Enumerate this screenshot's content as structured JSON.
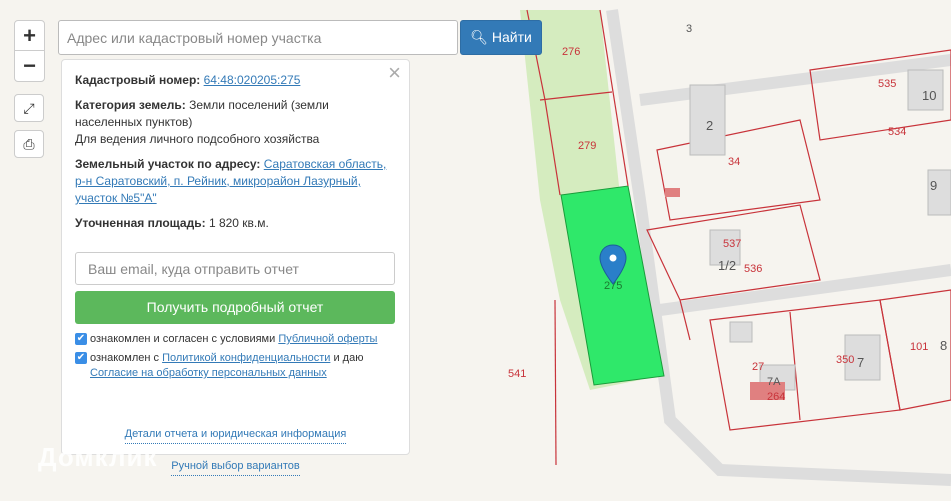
{
  "search": {
    "placeholder": "Адрес или кадастровый номер участка",
    "button": "Найти"
  },
  "zoom": {
    "in": "+",
    "out": "−"
  },
  "panel": {
    "cad_label": "Кадастровый номер:",
    "cad_value": "64:48:020205:275",
    "cat_label": "Категория земель:",
    "cat_value": "Земли поселений (земли населенных пунктов)",
    "use": "Для ведения личного подсобного хозяйства",
    "addr_label": "Земельный участок по адресу:",
    "addr_value": "Саратовская область, р-н Саратовский, п. Рейник, микрорайон Лазурный, участок №5\"А\"",
    "area_label": "Уточненная площадь:",
    "area_value": "1 820 кв.м.",
    "email_placeholder": "Ваш email, куда отправить отчет",
    "get_report": "Получить подробный отчет",
    "agree1_text": "ознакомлен и согласен с условиями",
    "agree1_link": "Публичной оферты",
    "agree2_text": "ознакомлен с",
    "agree2_link": "Политикой конфиденциальности",
    "agree2_tail": "и даю",
    "agree2_link2": "Согласие на обработку персональных данных",
    "details": "Детали отчета и юридическая информация",
    "manual": "Ручной выбор вариантов"
  },
  "map_labels": [
    "3",
    "276",
    "10",
    "535",
    "2",
    "534",
    "279",
    "34",
    "9",
    "537",
    "1/2",
    "536",
    "275",
    "541",
    "27",
    "350",
    "7",
    "101",
    "8",
    "7А",
    "264"
  ],
  "watermark": "Домклик"
}
